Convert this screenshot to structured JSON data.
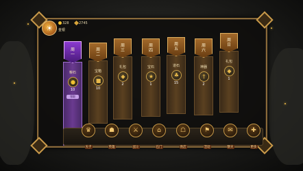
{
  "header": {
    "coins": "328",
    "gems": "2745",
    "rank_label": "金银"
  },
  "days": [
    {
      "day": "周一",
      "reward_name": "粮石",
      "qty": "10",
      "claim_label": "领取",
      "icon": "coin-icon",
      "active": true
    },
    {
      "day": "周二",
      "reward_name": "宝箱",
      "qty": "10",
      "icon": "chest-icon"
    },
    {
      "day": "周三",
      "reward_name": "礼包",
      "qty": "2",
      "icon": "bag-icon"
    },
    {
      "day": "周四",
      "reward_name": "宝石",
      "qty": "1",
      "icon": "star-icon"
    },
    {
      "day": "周五",
      "reward_name": "道石",
      "qty": "15",
      "icon": "leaf-icon"
    },
    {
      "day": "周六",
      "reward_name": "神器",
      "qty": "2",
      "icon": "sword-icon"
    },
    {
      "day": "周日",
      "reward_name": "礼包",
      "qty": "1",
      "icon": "bag-icon"
    }
  ],
  "nav": [
    {
      "label": "天子",
      "icon": "crown-icon"
    },
    {
      "label": "英雄",
      "icon": "helmet-icon"
    },
    {
      "label": "战斗",
      "icon": "swords-icon"
    },
    {
      "label": "石门",
      "icon": "gate-icon"
    },
    {
      "label": "商店",
      "icon": "shop-icon"
    },
    {
      "label": "活动",
      "icon": "flag-icon"
    },
    {
      "label": "聊天",
      "icon": "chat-icon"
    },
    {
      "label": "更多",
      "icon": "more-icon"
    }
  ],
  "colors": {
    "accent": "#c99a4a",
    "active": "#8a3ad0",
    "frame": "#8a6a3a"
  }
}
